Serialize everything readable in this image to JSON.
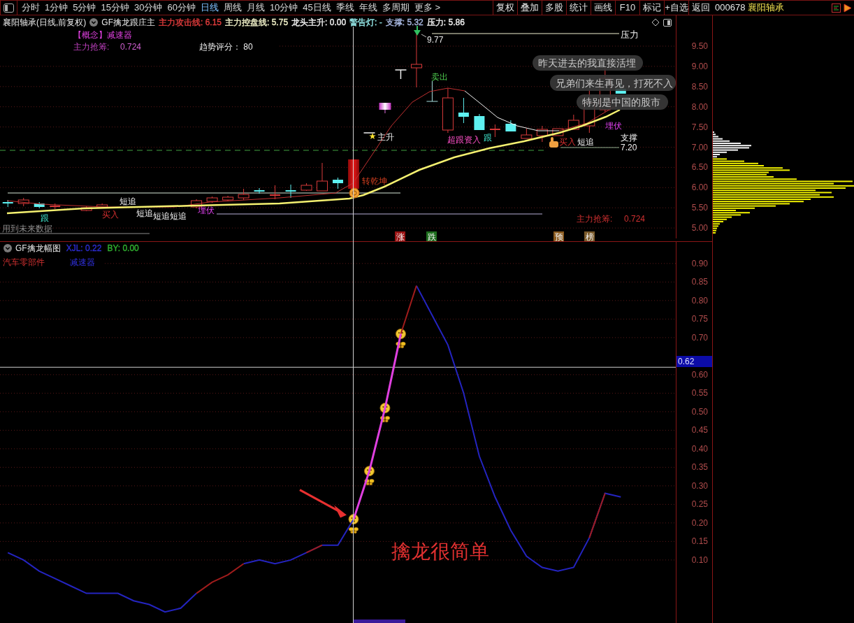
{
  "toolbar": {
    "tabs": [
      {
        "label": "分时",
        "selected": false
      },
      {
        "label": "1分钟",
        "selected": false
      },
      {
        "label": "5分钟",
        "selected": false
      },
      {
        "label": "15分钟",
        "selected": false
      },
      {
        "label": "30分钟",
        "selected": false
      },
      {
        "label": "60分钟",
        "selected": false
      },
      {
        "label": "日线",
        "selected": true
      },
      {
        "label": "周线",
        "selected": false
      },
      {
        "label": "月线",
        "selected": false
      },
      {
        "label": "10分钟",
        "selected": false
      },
      {
        "label": "45日线",
        "selected": false
      },
      {
        "label": "季线",
        "selected": false
      },
      {
        "label": "年线",
        "selected": false
      },
      {
        "label": "多周期",
        "selected": false
      },
      {
        "label": "更多 >",
        "selected": false
      }
    ],
    "buttons": [
      "复权",
      "叠加",
      "多股",
      "统计",
      "画线",
      "F10",
      "标记",
      "+自选",
      "返回"
    ]
  },
  "quote_panel": {
    "code": "000678",
    "name": "襄阳轴承"
  },
  "main_chart": {
    "title": "襄阳轴承(日线,前复权)",
    "indicator": "GF擒龙跟庄主",
    "readouts": [
      {
        "text": "主力攻击线: 6.15",
        "color": "#e03c3c"
      },
      {
        "text": "主力控盘线: 5.75",
        "color": "#f0f0c8"
      },
      {
        "text": "龙头主升: 0.00",
        "color": "#f0f0f0"
      },
      {
        "text": "警告灯: -",
        "color": "#90e0e0"
      },
      {
        "text": "支撑: 5.32",
        "color": "#a8b8e0"
      },
      {
        "text": "压力: 5.86",
        "color": "#f0f0f0"
      }
    ],
    "concept": "【概念】减速器",
    "chip_grab_label": "主力抢筹:",
    "chip_grab_value": "0.724",
    "trend_score": "趋势评分： 80",
    "signals": [
      {
        "text": "跟",
        "kind": "follow"
      },
      {
        "text": "买入",
        "kind": "buy"
      },
      {
        "text": "短追",
        "kind": "chase"
      },
      {
        "text": "短追",
        "kind": "chase"
      },
      {
        "text": "短追",
        "kind": "chase"
      },
      {
        "text": "短追",
        "kind": "chase"
      },
      {
        "text": "埋伏",
        "kind": "ambush"
      },
      {
        "text": "转乾坤",
        "kind": "turn"
      },
      {
        "text": "主升",
        "kind": "rise"
      },
      {
        "text": "卖出",
        "kind": "sell"
      },
      {
        "text": "超跟资入",
        "kind": "entry"
      },
      {
        "text": "跟",
        "kind": "follow"
      },
      {
        "text": "买入",
        "kind": "buy"
      },
      {
        "text": "短追",
        "kind": "chase"
      },
      {
        "text": "埋伏",
        "kind": "ambush"
      }
    ],
    "high_price": "9.77",
    "pressure_label": "压力",
    "support_label": "支撑",
    "support_price": "7.20",
    "comments": [
      "昨天进去的我直接活埋",
      "兄弟们来生再见，打死不入",
      "特别是中国的股市"
    ],
    "future_data_note": "用到未来数据",
    "footer_label": "主力抢筹:",
    "footer_value": "0.724",
    "tags": [
      {
        "text": "涨",
        "color": "#9a1414"
      },
      {
        "text": "跌",
        "color": "#1e6e1e"
      },
      {
        "text": "预",
        "color": "#8a5a1e"
      },
      {
        "text": "榜",
        "color": "#7a5a2a"
      }
    ],
    "price_axis": [
      "9.50",
      "9.00",
      "8.50",
      "8.00",
      "7.50",
      "7.00",
      "6.50",
      "6.00",
      "5.50",
      "5.00"
    ]
  },
  "sub_chart": {
    "title": "GF擒龙幅图",
    "readouts": [
      {
        "text": "XJL: 0.22",
        "color": "#2c2cd0"
      },
      {
        "text": "BY: 0.00",
        "color": "#30b030"
      }
    ],
    "sector": "汽车零部件",
    "concept": "减速器",
    "annotation": "擒龙很简单",
    "chart_data": {
      "type": "line",
      "grid": true,
      "ylim": [
        -0.07,
        0.96
      ],
      "yticks": [
        {
          "value": 0.9,
          "label": "0.90"
        },
        {
          "value": 0.85,
          "label": "0.85"
        },
        {
          "value": 0.8,
          "label": "0.80"
        },
        {
          "value": 0.75,
          "label": "0.75"
        },
        {
          "value": 0.7,
          "label": "0.70"
        },
        {
          "value": 0.6,
          "label": "0.60"
        },
        {
          "value": 0.55,
          "label": "0.55"
        },
        {
          "value": 0.5,
          "label": "0.50"
        },
        {
          "value": 0.45,
          "label": "0.45"
        },
        {
          "value": 0.4,
          "label": "0.40"
        },
        {
          "value": 0.35,
          "label": "0.35"
        },
        {
          "value": 0.3,
          "label": "0.30"
        },
        {
          "value": 0.25,
          "label": "0.25"
        },
        {
          "value": 0.2,
          "label": "0.20"
        },
        {
          "value": 0.15,
          "label": "0.15"
        },
        {
          "value": 0.1,
          "label": "0.10"
        }
      ],
      "ref_lines": [
        {
          "axis": "y",
          "value": 0.62,
          "label": "0.62"
        }
      ],
      "series": [
        {
          "color": "#2424c0",
          "values": [
            0.12,
            0.1,
            0.07,
            0.05,
            0.03,
            0.01,
            0.01,
            0.01,
            -0.01,
            -0.02,
            -0.04,
            -0.03,
            0.01,
            null,
            null,
            0.09,
            0.1,
            0.09,
            0.1,
            0.12,
            0.14,
            0.14,
            0.21,
            null,
            null,
            null,
            0.84,
            0.76,
            0.68,
            0.55,
            0.38,
            0.27,
            0.18,
            0.11,
            0.08,
            0.07,
            0.08,
            0.16,
            0.28,
            0.27,
            null,
            null,
            null
          ]
        },
        {
          "color": "#a01c1c",
          "values": [
            null,
            null,
            null,
            null,
            null,
            null,
            null,
            null,
            null,
            null,
            null,
            null,
            0.01,
            0.04,
            0.06,
            0.09,
            null,
            null,
            null,
            0.12,
            0.14,
            null,
            null,
            null,
            null,
            0.71,
            0.84,
            null,
            null,
            null,
            null,
            null,
            null,
            null,
            null,
            null,
            null,
            0.16,
            0.28,
            null,
            null,
            null,
            null
          ]
        },
        {
          "color": "#e040e0",
          "values": [
            null,
            null,
            null,
            null,
            null,
            null,
            null,
            null,
            null,
            null,
            null,
            null,
            null,
            null,
            null,
            null,
            null,
            null,
            null,
            null,
            null,
            null,
            0.21,
            0.34,
            0.51,
            0.71,
            null,
            null,
            null,
            null,
            null,
            null,
            null,
            null,
            null,
            null,
            null,
            null,
            null,
            null,
            null,
            null,
            null
          ]
        }
      ]
    }
  }
}
